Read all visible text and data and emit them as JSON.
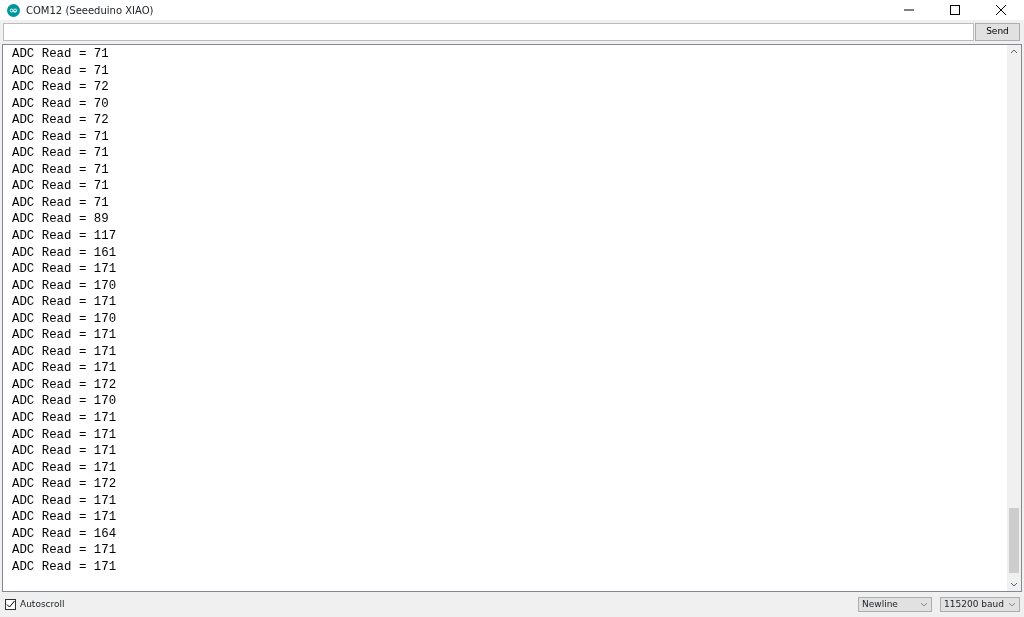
{
  "window": {
    "title": "COM12 (Seeeduino XIAO)"
  },
  "send_button": "Send",
  "output": [
    "ADC Read = 71",
    "ADC Read = 71",
    "ADC Read = 72",
    "ADC Read = 70",
    "ADC Read = 72",
    "ADC Read = 71",
    "ADC Read = 71",
    "ADC Read = 71",
    "ADC Read = 71",
    "ADC Read = 71",
    "ADC Read = 89",
    "ADC Read = 117",
    "ADC Read = 161",
    "ADC Read = 171",
    "ADC Read = 170",
    "ADC Read = 171",
    "ADC Read = 170",
    "ADC Read = 171",
    "ADC Read = 171",
    "ADC Read = 171",
    "ADC Read = 172",
    "ADC Read = 170",
    "ADC Read = 171",
    "ADC Read = 171",
    "ADC Read = 171",
    "ADC Read = 171",
    "ADC Read = 172",
    "ADC Read = 171",
    "ADC Read = 171",
    "ADC Read = 164",
    "ADC Read = 171",
    "ADC Read = 171"
  ],
  "autoscroll": {
    "label": "Autoscroll",
    "checked": true
  },
  "line_ending": "Newline",
  "baud_rate": "115200 baud"
}
